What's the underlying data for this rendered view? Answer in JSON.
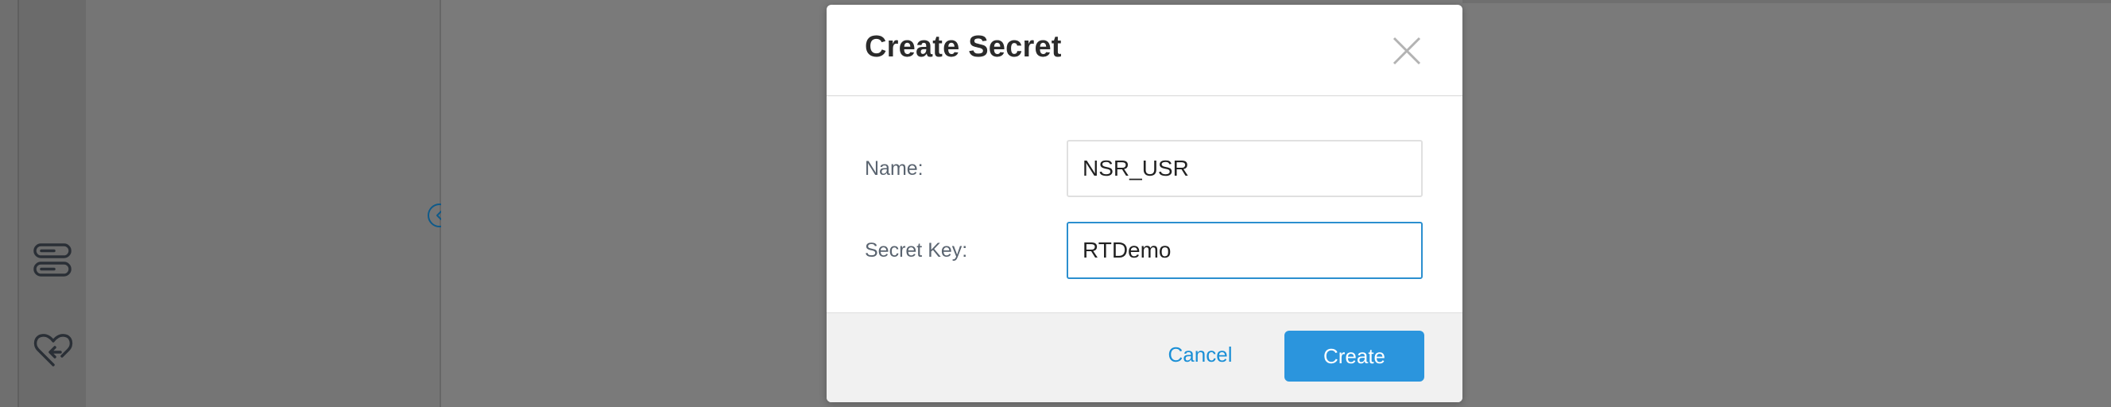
{
  "sidebar": {
    "items": [
      {
        "icon": "list-icon"
      },
      {
        "icon": "heart-return-icon"
      }
    ]
  },
  "panel": {
    "collapse_icon": "chevron-left-icon"
  },
  "dialog": {
    "title": "Create Secret",
    "close_icon": "close-icon",
    "fields": [
      {
        "label": "Name:",
        "value": "NSR_USR"
      },
      {
        "label": "Secret Key:",
        "value": "RTDemo"
      }
    ],
    "cancel_label": "Cancel",
    "create_label": "Create"
  },
  "colors": {
    "accent": "#2b95dd",
    "link": "#1a8fd6",
    "overlay": "#7a7a7a"
  }
}
